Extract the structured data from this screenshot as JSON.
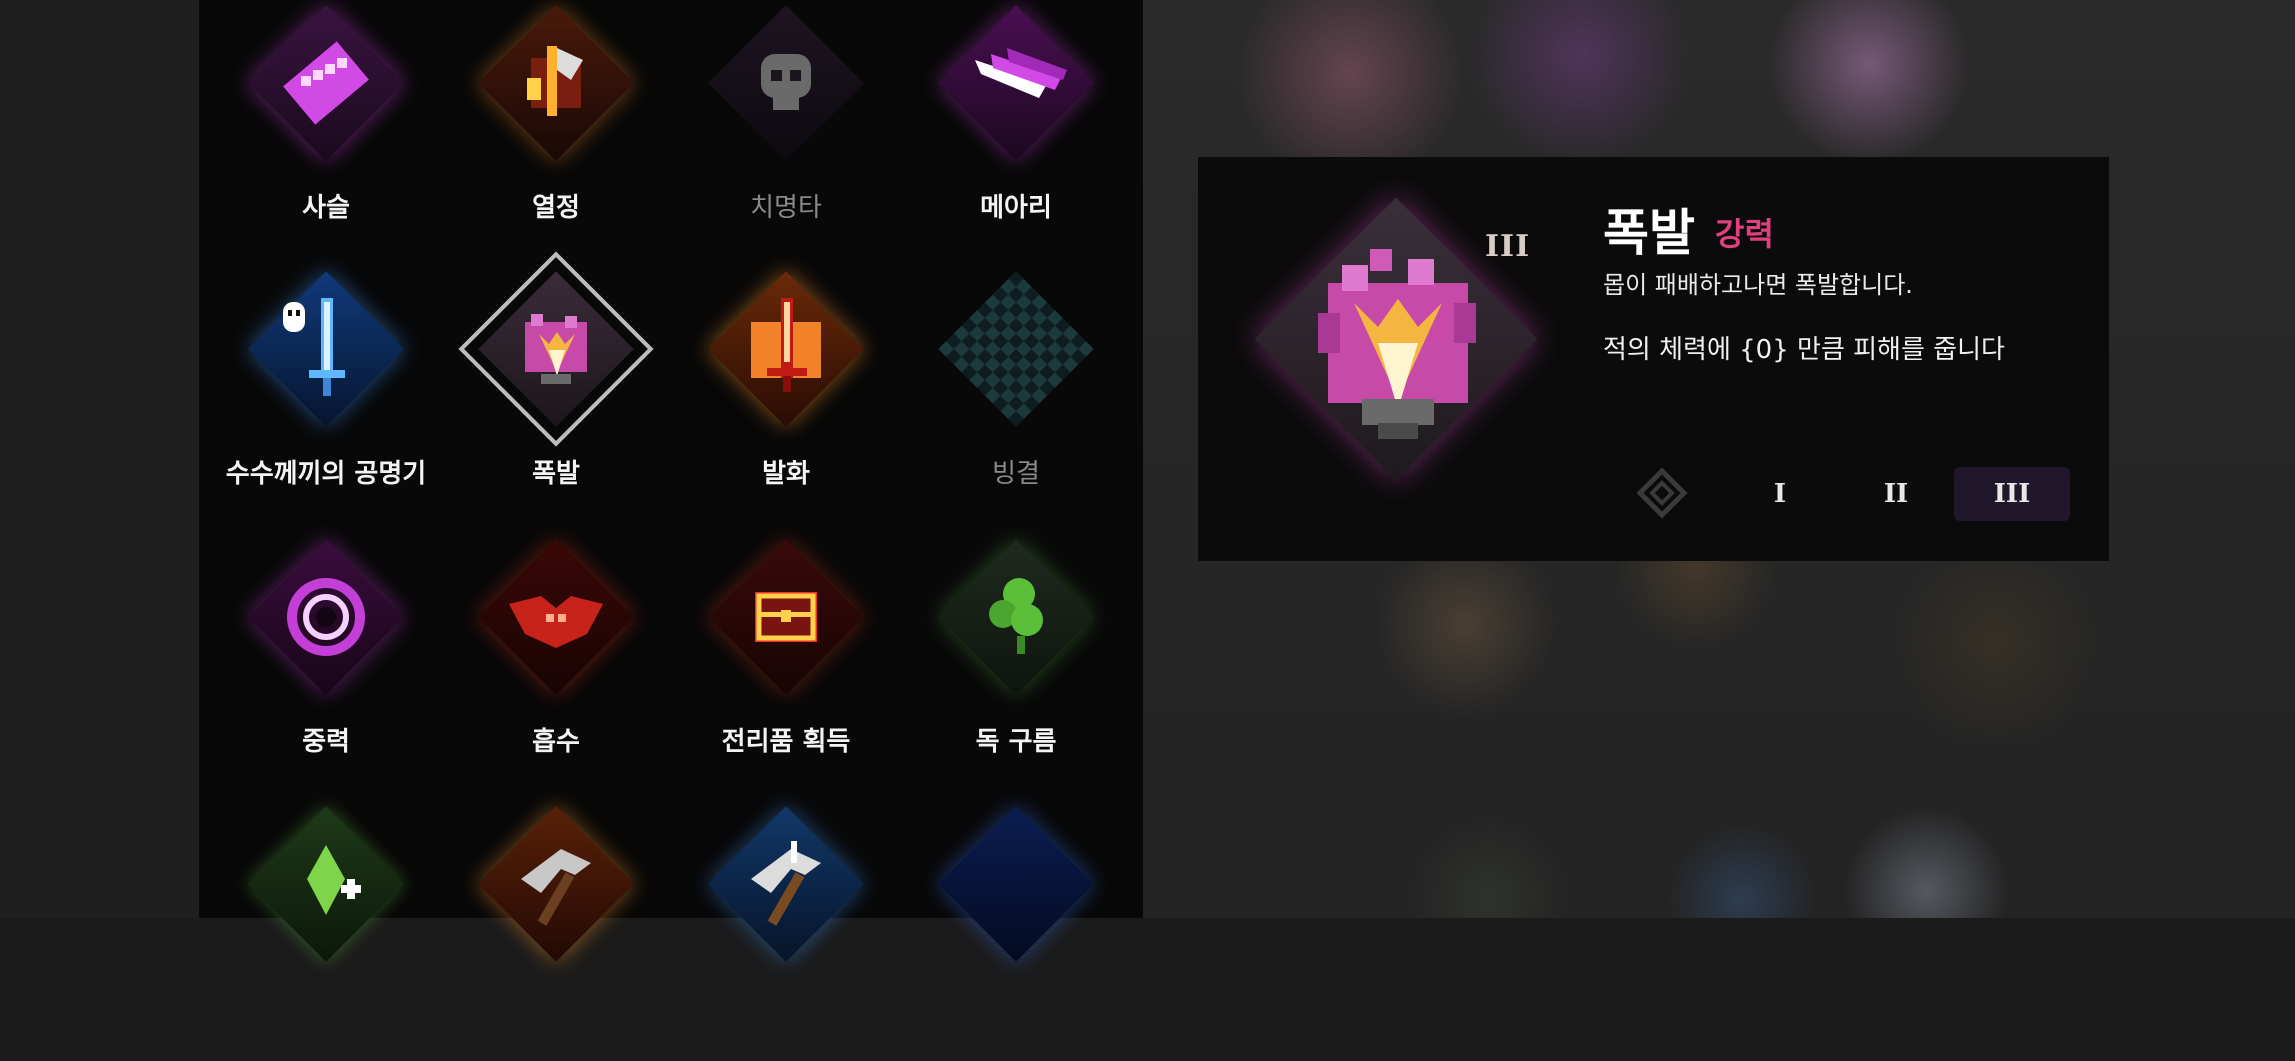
{
  "skills": [
    {
      "label": "사슬",
      "locked": false,
      "icon": "chain-icon"
    },
    {
      "label": "열정",
      "locked": false,
      "icon": "fire-axe-icon"
    },
    {
      "label": "치명타",
      "locked": true,
      "icon": "skull-icon"
    },
    {
      "label": "메아리",
      "locked": false,
      "icon": "echo-blade-icon"
    },
    {
      "label": "수수께끼의 공명기",
      "locked": false,
      "icon": "ghost-sword-icon"
    },
    {
      "label": "폭발",
      "locked": false,
      "icon": "explosion-icon",
      "selected": true
    },
    {
      "label": "발화",
      "locked": false,
      "icon": "flame-sword-icon"
    },
    {
      "label": "빙결",
      "locked": true,
      "icon": "checker-ice-icon"
    },
    {
      "label": "중력",
      "locked": false,
      "icon": "gravity-eye-icon"
    },
    {
      "label": "흡수",
      "locked": false,
      "icon": "bat-icon"
    },
    {
      "label": "전리품 획득",
      "locked": false,
      "icon": "treasure-chest-icon"
    },
    {
      "label": "독 구름",
      "locked": false,
      "icon": "poison-cloud-icon"
    },
    {
      "label": "",
      "locked": false,
      "icon": "green-crystal-icon"
    },
    {
      "label": "",
      "locked": false,
      "icon": "fire-pickaxe-icon"
    },
    {
      "label": "",
      "locked": false,
      "icon": "ice-pickaxe-icon"
    },
    {
      "label": "",
      "locked": false,
      "icon": "crescent-icon"
    }
  ],
  "detail": {
    "title": "폭발",
    "tier": "강력",
    "rank_badge": "III",
    "description": "몹이 패배하고나면 폭발합니다.",
    "effect": "적의 체력에 {0} 만큼 피해를 줍니다",
    "ranks": [
      "I",
      "II",
      "III"
    ],
    "active_rank": "III"
  },
  "colors": {
    "accent": "#e0407e",
    "panel": "#080808",
    "active_rank_bg": "#21172a"
  }
}
